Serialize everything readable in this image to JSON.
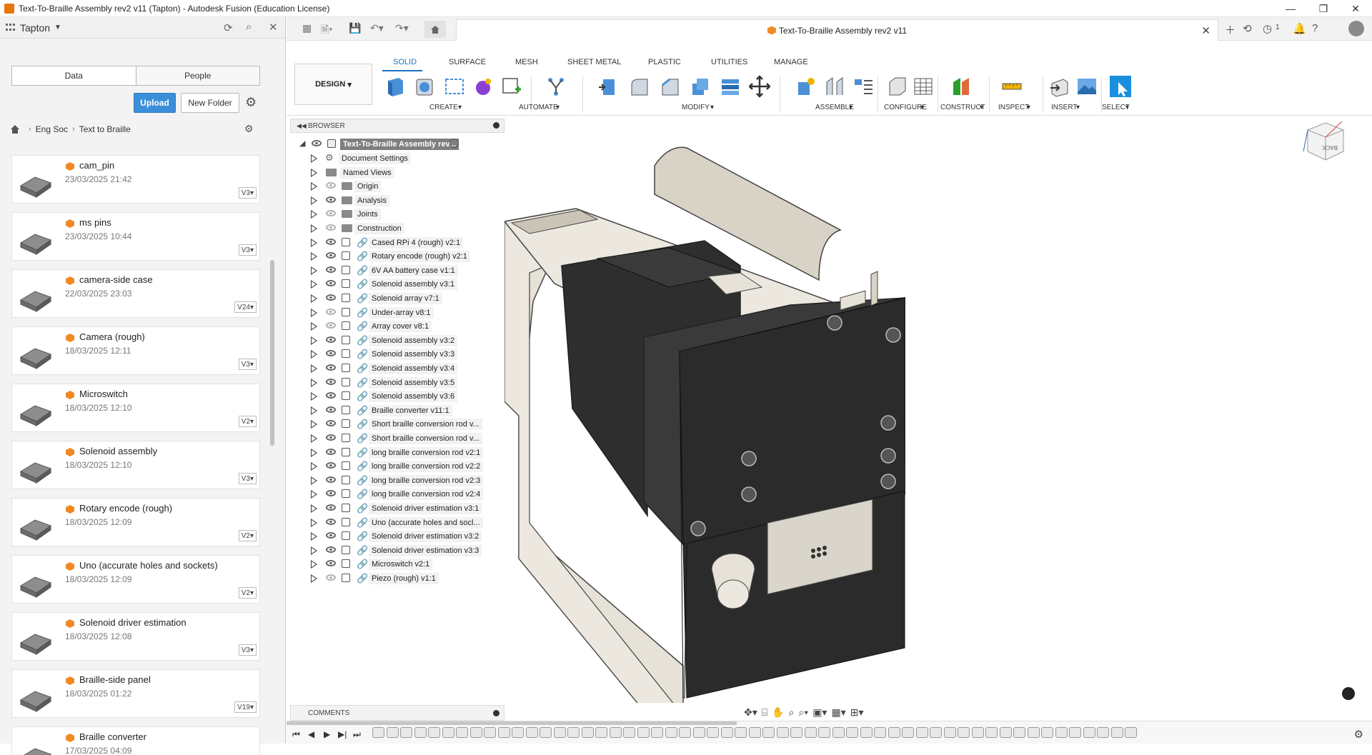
{
  "window": {
    "title": "Text-To-Braille Assembly rev2 v11 (Tapton) - Autodesk Fusion (Education License)",
    "minimize": "—",
    "restore": "❐",
    "close": "✕"
  },
  "data_panel": {
    "team": "Tapton",
    "tabs": [
      "Data",
      "People"
    ],
    "upload_label": "Upload",
    "new_folder_label": "New Folder",
    "breadcrumb": [
      "Eng Soc",
      "Text to Braille"
    ],
    "files": [
      {
        "name": "cam_pin",
        "date": "23/03/2025 21:42",
        "version": "V3"
      },
      {
        "name": "ms pins",
        "date": "23/03/2025 10:44",
        "version": "V3"
      },
      {
        "name": "camera-side case",
        "date": "22/03/2025 23:03",
        "version": "V24"
      },
      {
        "name": "Camera (rough)",
        "date": "18/03/2025 12:11",
        "version": "V3"
      },
      {
        "name": "Microswitch",
        "date": "18/03/2025 12:10",
        "version": "V2"
      },
      {
        "name": "Solenoid assembly",
        "date": "18/03/2025 12:10",
        "version": "V3"
      },
      {
        "name": "Rotary encode (rough)",
        "date": "18/03/2025 12:09",
        "version": "V2"
      },
      {
        "name": "Uno (accurate holes and sockets)",
        "date": "18/03/2025 12:09",
        "version": "V2"
      },
      {
        "name": "Solenoid driver estimation",
        "date": "18/03/2025 12:08",
        "version": "V3"
      },
      {
        "name": "Braille-side panel",
        "date": "18/03/2025 01:22",
        "version": "V19"
      },
      {
        "name": "Braille converter",
        "date": "17/03/2025 04:09",
        "version": ""
      }
    ]
  },
  "doc_tab": {
    "title": "Text-To-Braille Assembly rev2 v11",
    "updates_count": "1"
  },
  "toolbar": {
    "design_label": "DESIGN",
    "workspace_tabs": [
      "SOLID",
      "SURFACE",
      "MESH",
      "SHEET METAL",
      "PLASTIC",
      "UTILITIES",
      "MANAGE"
    ],
    "groups": [
      "CREATE",
      "AUTOMATE",
      "MODIFY",
      "ASSEMBLE",
      "CONFIGURE",
      "CONSTRUCT",
      "INSPECT",
      "INSERT",
      "SELECT"
    ]
  },
  "browser": {
    "title": "BROWSER",
    "root": "Text-To-Braille Assembly rev...",
    "items": [
      {
        "label": "Document Settings",
        "kind": "settings",
        "visible": true
      },
      {
        "label": "Named Views",
        "kind": "folder",
        "visible": true
      },
      {
        "label": "Origin",
        "kind": "folder",
        "visible": false
      },
      {
        "label": "Analysis",
        "kind": "folder",
        "visible": true
      },
      {
        "label": "Joints",
        "kind": "folder",
        "visible": false
      },
      {
        "label": "Construction",
        "kind": "folder",
        "visible": false
      },
      {
        "label": "Cased RPi 4 (rough) v2:1",
        "kind": "component",
        "visible": true
      },
      {
        "label": "Rotary encode (rough) v2:1",
        "kind": "component",
        "visible": true
      },
      {
        "label": "6V AA battery case v1:1",
        "kind": "component",
        "visible": true
      },
      {
        "label": "Solenoid assembly v3:1",
        "kind": "component",
        "visible": true
      },
      {
        "label": "Solenoid array v7:1",
        "kind": "component",
        "visible": true
      },
      {
        "label": "Under-array v8:1",
        "kind": "component",
        "visible": false
      },
      {
        "label": "Array cover v8:1",
        "kind": "component",
        "visible": false
      },
      {
        "label": "Solenoid assembly v3:2",
        "kind": "component",
        "visible": true
      },
      {
        "label": "Solenoid assembly v3:3",
        "kind": "component",
        "visible": true
      },
      {
        "label": "Solenoid assembly v3:4",
        "kind": "component",
        "visible": true
      },
      {
        "label": "Solenoid assembly v3:5",
        "kind": "component",
        "visible": true
      },
      {
        "label": "Solenoid assembly v3:6",
        "kind": "component",
        "visible": true
      },
      {
        "label": "Braille converter v11:1",
        "kind": "component",
        "visible": true
      },
      {
        "label": "Short braille conversion rod v...",
        "kind": "component",
        "visible": true
      },
      {
        "label": "Short braille conversion rod v...",
        "kind": "component",
        "visible": true
      },
      {
        "label": "long braille conversion rod v2:1",
        "kind": "component",
        "visible": true
      },
      {
        "label": "long braille conversion rod v2:2",
        "kind": "component",
        "visible": true
      },
      {
        "label": "long braille conversion rod v2:3",
        "kind": "component",
        "visible": true
      },
      {
        "label": "long braille conversion rod v2:4",
        "kind": "component",
        "visible": true
      },
      {
        "label": "Solenoid driver estimation v3:1",
        "kind": "component",
        "visible": true
      },
      {
        "label": "Uno (accurate holes and socl...",
        "kind": "component",
        "visible": true
      },
      {
        "label": "Solenoid driver estimation v3:2",
        "kind": "component",
        "visible": true
      },
      {
        "label": "Solenoid driver estimation v3:3",
        "kind": "component",
        "visible": true
      },
      {
        "label": "Microswitch v2:1",
        "kind": "component",
        "visible": true
      },
      {
        "label": "Piezo (rough) v1:1",
        "kind": "component",
        "visible": false
      }
    ]
  },
  "comments": {
    "label": "COMMENTS"
  },
  "viewcube": {
    "face": "BACK"
  },
  "colors": {
    "accent": "#1a6fc1",
    "upload": "#3b8fd9",
    "file_icon": "#f08a24",
    "case_light": "#e6e2d8",
    "case_dark": "#2e2e2e"
  }
}
